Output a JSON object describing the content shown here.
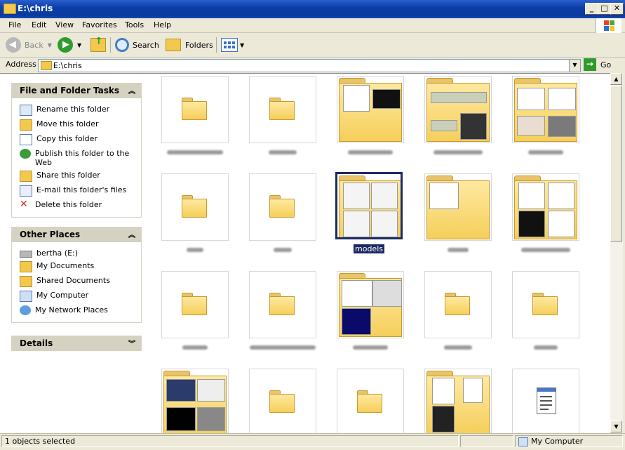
{
  "window": {
    "title": "E:\\chris"
  },
  "menu": [
    "File",
    "Edit",
    "View",
    "Favorites",
    "Tools",
    "Help"
  ],
  "toolbar": {
    "back": "Back",
    "search": "Search",
    "folders": "Folders"
  },
  "address": {
    "label": "Address",
    "value": "E:\\chris",
    "go": "Go"
  },
  "tasks": {
    "header": "File and Folder Tasks",
    "items": [
      "Rename this folder",
      "Move this folder",
      "Copy this folder",
      "Publish this folder to the Web",
      "Share this folder",
      "E-mail this folder's files",
      "Delete this folder"
    ]
  },
  "places": {
    "header": "Other Places",
    "items": [
      "bertha (E:)",
      "My Documents",
      "Shared Documents",
      "My Computer",
      "My Network Places"
    ]
  },
  "details": {
    "header": "Details"
  },
  "items": {
    "selected_label": "models"
  },
  "status": {
    "left": "1 objects selected",
    "right": "My Computer"
  },
  "colors": {
    "titlebar": "#0b3fa8",
    "selection": "#1c2a63",
    "folder": "#f5cf5b"
  }
}
